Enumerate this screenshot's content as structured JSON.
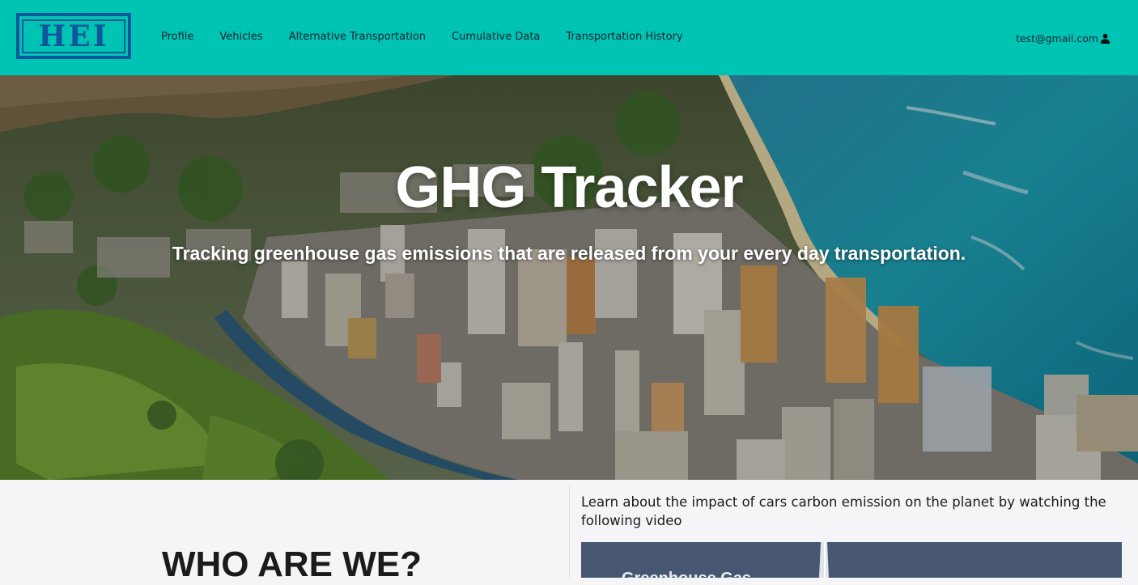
{
  "navbar": {
    "logo_text": "HEI",
    "links": [
      "Profile",
      "Vehicles",
      "Alternative Transportation",
      "Cumulative Data",
      "Transportation History"
    ],
    "user_email": "test@gmail.com",
    "user_icon": "user-icon",
    "background_color": "#00c4b3",
    "logo_color": "#10569b"
  },
  "hero": {
    "title": "GHG Tracker",
    "subtitle": "Tracking greenhouse gas emissions that are released from your every day transportation."
  },
  "about": {
    "heading": "WHO ARE WE?"
  },
  "video_section": {
    "description": "Learn about the impact of cars carbon emission on the planet by watching the following video",
    "thumbnail_text": "Greenhouse Gas"
  }
}
